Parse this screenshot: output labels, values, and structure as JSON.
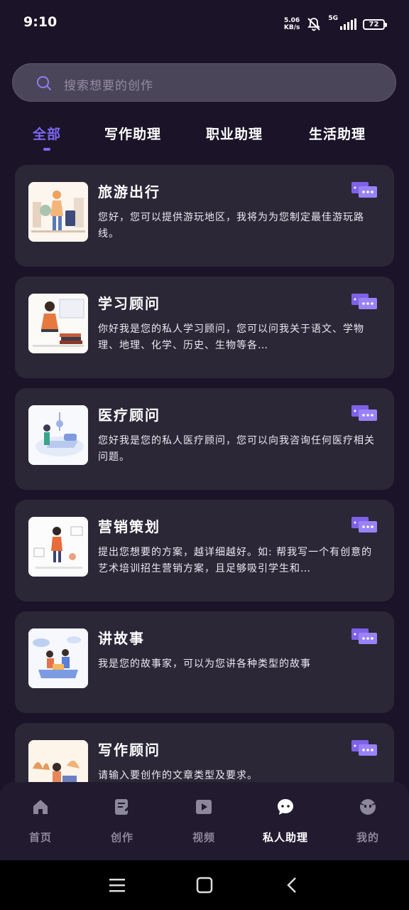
{
  "status_bar": {
    "time": "9:10",
    "net_speed_value": "5.06",
    "net_speed_unit": "KB/s",
    "network": "5G",
    "battery": "72"
  },
  "search": {
    "placeholder": "搜索想要的创作"
  },
  "tabs": [
    {
      "label": "全部",
      "active": true
    },
    {
      "label": "写作助理",
      "active": false
    },
    {
      "label": "职业助理",
      "active": false
    },
    {
      "label": "生活助理",
      "active": false
    }
  ],
  "cards": [
    {
      "title": "旅游出行",
      "desc": "您好，您可以提供游玩地区，我将为为您制定最佳游玩路线。",
      "icon": "chat-bubbles-icon"
    },
    {
      "title": "学习顾问",
      "desc": "你好我是您的私人学习顾问，您可以问我关于语文、学物理、地理、化学、历史、生物等各…",
      "icon": "chat-bubbles-icon"
    },
    {
      "title": "医疗顾问",
      "desc": "您好我是您的私人医疗顾问，您可以向我咨询任何医疗相关问题。",
      "icon": "chat-bubbles-icon"
    },
    {
      "title": "营销策划",
      "desc": "提出您想要的方案，越详细越好。如: 帮我写一个有创意的艺术培训招生营销方案，且足够吸引学生和…",
      "icon": "chat-bubbles-icon"
    },
    {
      "title": "讲故事",
      "desc": "我是您的故事家，可以为您讲各种类型的故事",
      "icon": "chat-bubbles-icon"
    },
    {
      "title": "写作顾问",
      "desc": "请输入要创作的文章类型及要求。",
      "icon": "chat-bubbles-icon"
    }
  ],
  "bottom_nav": [
    {
      "label": "首页",
      "icon": "home-icon",
      "active": false
    },
    {
      "label": "创作",
      "icon": "edit-note-icon",
      "active": false
    },
    {
      "label": "视频",
      "icon": "video-play-icon",
      "active": false
    },
    {
      "label": "私人助理",
      "icon": "assistant-chat-icon",
      "active": true
    },
    {
      "label": "我的",
      "icon": "profile-face-icon",
      "active": false
    }
  ],
  "colors": {
    "accent": "#7c67f0",
    "background": "#1b1428",
    "card": "#2b2737",
    "chat_icon": "#8b6cf2"
  }
}
